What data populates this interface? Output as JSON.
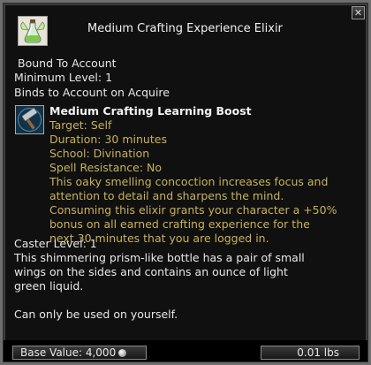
{
  "window": {
    "title": "Medium Crafting Experience Elixir",
    "close_icon": "x-icon",
    "item_icon": "potion-bottle-icon"
  },
  "properties": {
    "bound": "Bound To Account",
    "min_level": "Minimum Level: 1",
    "binds": "Binds to Account on Acquire"
  },
  "effect": {
    "icon": "hammer-icon",
    "name": "Medium Crafting Learning Boost",
    "target": "Target: Self",
    "duration": "Duration: 30 minutes",
    "school": "School: Divination",
    "spell_resistance": "Spell Resistance: No",
    "description_lines": [
      "This oaky smelling concoction increases focus and",
      "attention to detail and sharpens the mind.",
      "Consuming this elixir grants your character a +50%",
      "bonus on all earned crafting experience for the",
      "next 30 minutes that you are logged in."
    ]
  },
  "caster_level": "Caster Level: 1",
  "description_lines": [
    "This shimmering prism-like bottle has a pair of small",
    "wings on the sides and contains an ounce of light",
    "green liquid."
  ],
  "usage_note": "Can only be used on yourself.",
  "footer": {
    "base_value": "Base Value: 4,000",
    "coin_icon": "silver-coin-icon",
    "weight": "0.01 lbs"
  },
  "colors": {
    "effect_text": "#c8b25a",
    "body_text": "#e8e8e8",
    "background": "#101010"
  }
}
